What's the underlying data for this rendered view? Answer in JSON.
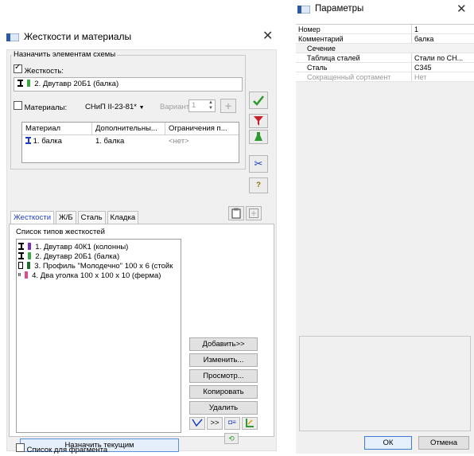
{
  "left": {
    "title": "Жесткости и материалы",
    "assign_group_label": "Назначить элементам схемы",
    "stiffness_label": "Жесткость:",
    "stiffness_checked": true,
    "selected_stiffness": "2. Двутавр 20Б1 (балка)",
    "materials_label": "Материалы:",
    "materials_checked": false,
    "standard_value": "СНиП II-23-81*",
    "variant_label": "Вариант",
    "variant_value": "1",
    "table": {
      "headers": [
        "Материал",
        "Дополнительны...",
        "Ограничения п..."
      ],
      "rows": [
        [
          "1. балка",
          "1. балка",
          "<нет>"
        ]
      ]
    },
    "tabs": [
      "Жесткости",
      "Ж/Б",
      "Сталь",
      "Кладка"
    ],
    "active_tab": "Жесткости",
    "list_title": "Список типов жесткостей",
    "stiffness_list": [
      {
        "label": "1. Двутавр 40К1 (колонны)",
        "color": "#7b2fbf",
        "icon": "i-beam-icon"
      },
      {
        "label": "2. Двутавр 20Б1 (балка)",
        "color": "#3aa845",
        "icon": "i-beam-icon"
      },
      {
        "label": "3. Профиль \"Молодечно\" 100 х 6 (стойк",
        "color": "#1f6d2a",
        "icon": "square-tube-icon"
      },
      {
        "label": "4. Два уголка 100 х 100 х 10 (ферма)",
        "color": "#e0498a",
        "icon": "double-angle-icon"
      }
    ],
    "buttons": {
      "add": "Добавить>>",
      "edit": "Изменить...",
      "view": "Просмотр...",
      "copy": "Копировать",
      "delete": "Удалить",
      "more": ">>",
      "assign_current": "Назначить текущим"
    },
    "fragment_label": "Список для фрагмента",
    "colors": {
      "accent": "#1d3dbd",
      "check": "#2e9a2e",
      "filter": "#c8202a"
    }
  },
  "right": {
    "title": "Параметры",
    "properties": [
      {
        "name": "Номер",
        "value": "1",
        "kind": "normal"
      },
      {
        "name": "Комментарий",
        "value": "балка",
        "kind": "normal"
      },
      {
        "name": "Сечение",
        "value": "",
        "kind": "category"
      },
      {
        "name": "Таблица сталей",
        "value": "Стали по СН...",
        "kind": "sub"
      },
      {
        "name": "Сталь",
        "value": "С345",
        "kind": "sub"
      },
      {
        "name": "Сокращенный сортамент",
        "value": "Нет",
        "kind": "disabled"
      }
    ],
    "ok": "ОК",
    "cancel": "Отмена"
  }
}
